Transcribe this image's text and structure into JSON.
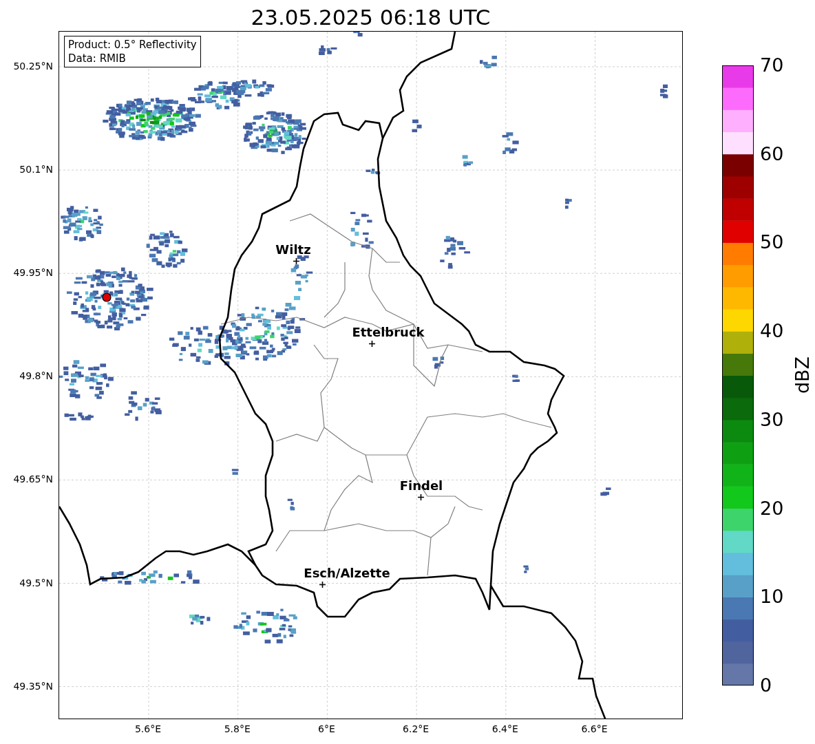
{
  "title": "23.05.2025 06:18 UTC",
  "info_box": {
    "product": "Product: 0.5° Reflectivity",
    "source": "Data: RMIB"
  },
  "cities": [
    {
      "name": "Wiltz"
    },
    {
      "name": "Ettelbruck"
    },
    {
      "name": "Findel"
    },
    {
      "name": "Esch/Alzette"
    }
  ],
  "y_ticks": [
    "50.25°N",
    "50.1°N",
    "49.95°N",
    "49.8°N",
    "49.65°N",
    "49.5°N",
    "49.35°N"
  ],
  "x_ticks": [
    "5.6°E",
    "5.8°E",
    "6°E",
    "6.2°E",
    "6.4°E",
    "6.6°E"
  ],
  "colorbar": {
    "label": "dBZ",
    "ticks": [
      "70",
      "60",
      "50",
      "40",
      "30",
      "20",
      "10",
      "0"
    ]
  }
}
